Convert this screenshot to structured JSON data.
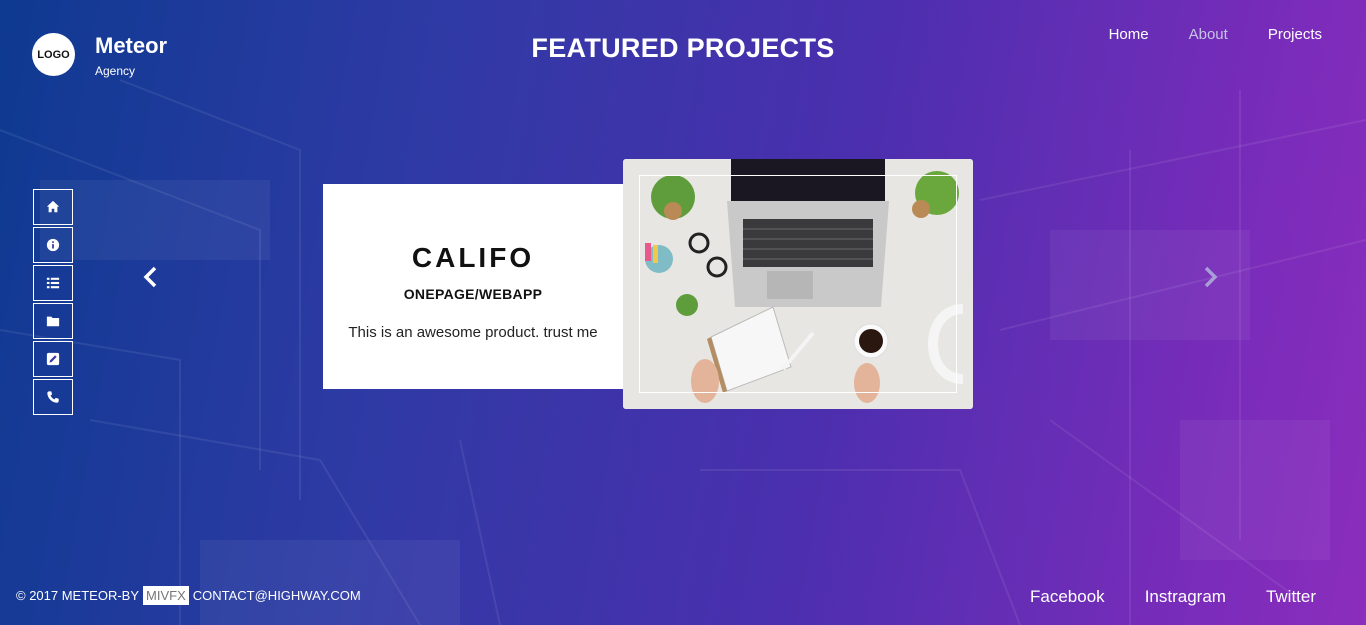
{
  "brand": {
    "logo_text": "LOGO",
    "name": "Meteor",
    "tagline": "Agency"
  },
  "page_title": "FEATURED PROJECTS",
  "top_nav": [
    {
      "label": "Home"
    },
    {
      "label": "About"
    },
    {
      "label": "Projects"
    }
  ],
  "side_nav": [
    {
      "icon": "home-icon"
    },
    {
      "icon": "info-icon"
    },
    {
      "icon": "list-icon"
    },
    {
      "icon": "folder-icon"
    },
    {
      "icon": "edit-icon"
    },
    {
      "icon": "phone-icon"
    }
  ],
  "project": {
    "title": "CALIFO",
    "subtitle": "ONEPAGE/WEBAPP",
    "description": "This is an awesome product. trust me",
    "image": "laptop-desk-photo"
  },
  "footer": {
    "copyright": "© 2017 METEOR-BY",
    "brand_tag": "MIVFX",
    "contact": "CONTACT@HIGHWAY.COM",
    "social": [
      {
        "label": "Facebook"
      },
      {
        "label": "Instragram"
      },
      {
        "label": "Twitter"
      }
    ]
  },
  "colors": {
    "gradient_start": "#0e3a91",
    "gradient_end": "#8b2dbd",
    "card_bg": "#ffffff",
    "muted_nav": "#c7c3e6"
  }
}
